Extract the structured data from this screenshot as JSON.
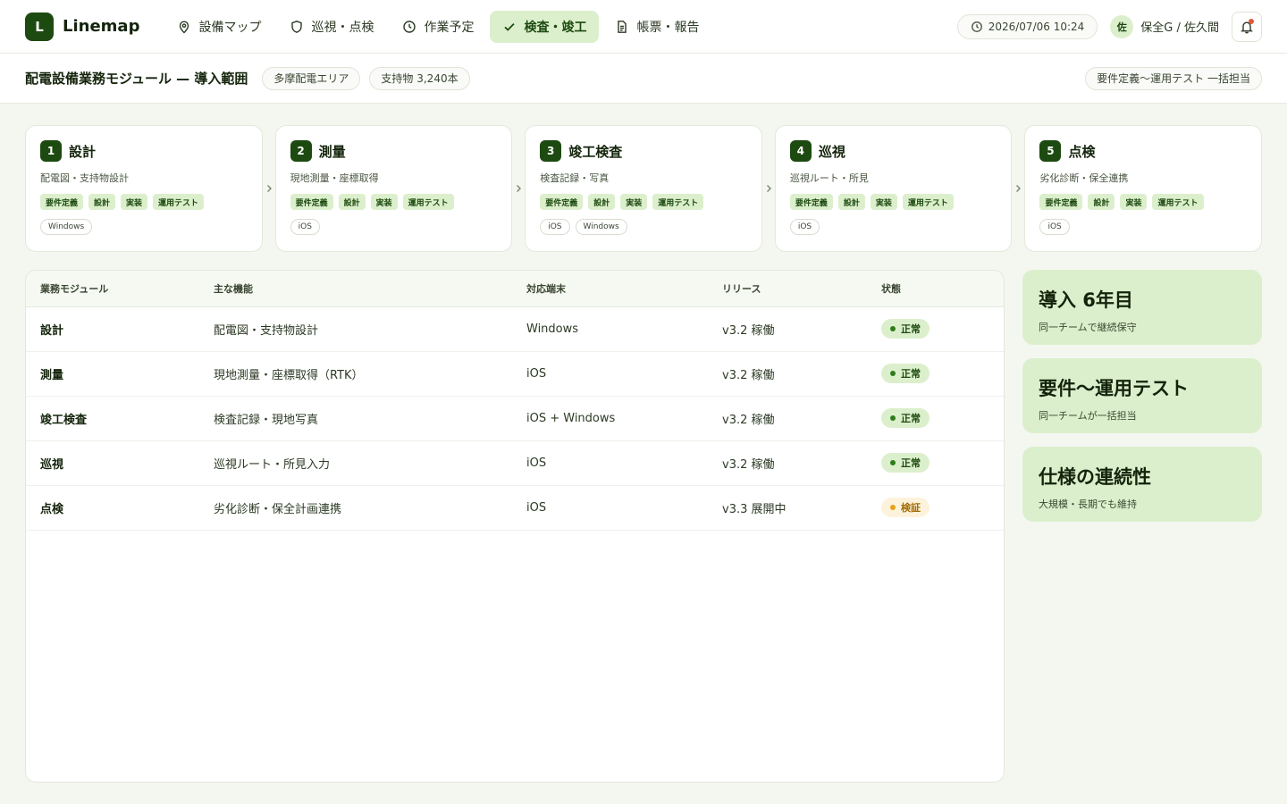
{
  "app": {
    "logo_letter": "L",
    "name": "Linemap"
  },
  "nav": [
    {
      "label": "設備マップ",
      "icon": "map-pin-icon"
    },
    {
      "label": "巡視・点検",
      "icon": "shield-icon"
    },
    {
      "label": "作業予定",
      "icon": "clock-icon"
    },
    {
      "label": "検査・竣工",
      "icon": "check-icon",
      "active": true
    },
    {
      "label": "帳票・報告",
      "icon": "document-icon"
    }
  ],
  "header": {
    "datetime": "2026/07/06 10:24",
    "user_initial": "佐",
    "user_name": "保全G / 佐久間"
  },
  "subheader": {
    "title": "配電設備業務モジュール — 導入範囲",
    "chips": [
      "多摩配電エリア",
      "支持物 3,240本"
    ],
    "right_chip": "要件定義〜運用テスト 一括担当"
  },
  "stages": [
    {
      "num": "1",
      "name": "設計",
      "desc": "配電図・支持物設計",
      "phases": [
        "要件定義",
        "設計",
        "実装",
        "運用テスト"
      ],
      "platforms": [
        "Windows"
      ]
    },
    {
      "num": "2",
      "name": "測量",
      "desc": "現地測量・座標取得",
      "phases": [
        "要件定義",
        "設計",
        "実装",
        "運用テスト"
      ],
      "platforms": [
        "iOS"
      ]
    },
    {
      "num": "3",
      "name": "竣工検査",
      "desc": "検査記録・写真",
      "phases": [
        "要件定義",
        "設計",
        "実装",
        "運用テスト"
      ],
      "platforms": [
        "iOS",
        "Windows"
      ]
    },
    {
      "num": "4",
      "name": "巡視",
      "desc": "巡視ルート・所見",
      "phases": [
        "要件定義",
        "設計",
        "実装",
        "運用テスト"
      ],
      "platforms": [
        "iOS"
      ]
    },
    {
      "num": "5",
      "name": "点検",
      "desc": "劣化診断・保全連携",
      "phases": [
        "要件定義",
        "設計",
        "実装",
        "運用テスト"
      ],
      "platforms": [
        "iOS"
      ]
    }
  ],
  "table": {
    "headers": [
      "業務モジュール",
      "主な機能",
      "対応端末",
      "リリース",
      "状態"
    ],
    "rows": [
      {
        "module": "設計",
        "feature": "配電図・支持物設計",
        "device": "Windows",
        "release": "v3.2 稼働",
        "status": "正常",
        "kind": "ok"
      },
      {
        "module": "測量",
        "feature": "現地測量・座標取得（RTK）",
        "device": "iOS",
        "release": "v3.2 稼働",
        "status": "正常",
        "kind": "ok"
      },
      {
        "module": "竣工検査",
        "feature": "検査記録・現地写真",
        "device": "iOS + Windows",
        "release": "v3.2 稼働",
        "status": "正常",
        "kind": "ok"
      },
      {
        "module": "巡視",
        "feature": "巡視ルート・所見入力",
        "device": "iOS",
        "release": "v3.2 稼働",
        "status": "正常",
        "kind": "ok"
      },
      {
        "module": "点検",
        "feature": "劣化診断・保全計画連携",
        "device": "iOS",
        "release": "v3.3 展開中",
        "status": "検証",
        "kind": "verify"
      }
    ]
  },
  "summary": [
    {
      "title": "導入 6年目",
      "sub": "同一チームで継続保守"
    },
    {
      "title": "要件〜運用テスト",
      "sub": "同一チームが一括担当"
    },
    {
      "title": "仕様の連続性",
      "sub": "大規模・長期でも維持"
    }
  ],
  "colors": {
    "accent": "#1d4a10",
    "accent_soft": "#dcefcc",
    "verify": "#a26a00"
  }
}
